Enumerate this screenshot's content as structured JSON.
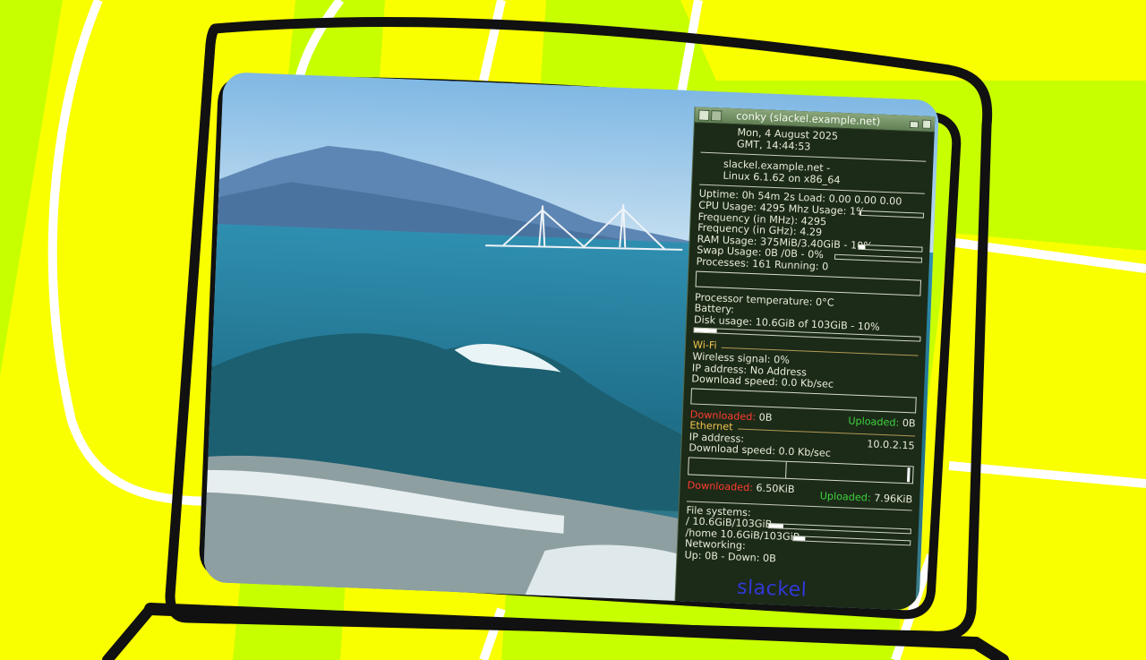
{
  "colors": {
    "background": "#c8ff00",
    "stripe": "#ffff00",
    "outline": "#111111",
    "conky_bg": "#1c2a18",
    "label_red": "#ff3b2f",
    "label_green": "#3ed23e",
    "label_gold": "#f2c34e"
  },
  "window": {
    "title": "conky (slackel.example.net)"
  },
  "datetime": {
    "line1": "Mon,   4 August 2025",
    "line2": "GMT,     14:44:53"
  },
  "host": {
    "line1": "slackel.example.net -",
    "line2": "Linux 6.1.62 on x86_64"
  },
  "system": {
    "uptime": "Uptime: 0h 54m 2s",
    "load": "Load: 0.00 0.00 0.00",
    "cpu": "CPU Usage:  4295 Mhz  Usage: 1%",
    "cpu_usage_fraction": 0.01,
    "freq_mhz": "Frequency (in MHz): 4295",
    "freq_ghz": "Frequency (in GHz): 4.29",
    "ram": "RAM Usage: 375MiB/3.40GiB - 10%",
    "ram_fraction": 0.1,
    "swap": "Swap Usage: 0B  /0B   - 0%",
    "swap_fraction": 0.0,
    "processes": "Processes: 161  Running: 0",
    "temperature": "Processor temperature: 0°C",
    "battery": "Battery:",
    "disk": "Disk usage: 10.6GiB of 103GiB - 10%",
    "disk_fraction": 0.1
  },
  "wifi": {
    "header": "Wi-Fi",
    "signal": "Wireless signal: 0%",
    "ip": "IP address: No Address",
    "speed": "Download speed: 0.0 Kb/sec",
    "downloaded_label": "Downloaded:",
    "downloaded_value": "0B",
    "uploaded_label": "Uploaded:",
    "uploaded_value": "0B"
  },
  "ethernet": {
    "header": "Ethernet",
    "ip_label": "IP address:",
    "ip_value": "10.0.2.15",
    "speed": "Download speed: 0.0 Kb/sec",
    "downloaded_label": "Downloaded:",
    "downloaded_value": "6.50KiB",
    "uploaded_label": "Uploaded:",
    "uploaded_value": "7.96KiB"
  },
  "filesystems": {
    "header": "File systems:",
    "root": "/ 10.6GiB/103GiB",
    "root_fraction": 0.1,
    "home": "/home 10.6GiB/103GiB",
    "home_fraction": 0.1
  },
  "networking": {
    "header": "Networking:",
    "line": "Up: 0B    - Down: 0B"
  },
  "logo_text": "slackel"
}
